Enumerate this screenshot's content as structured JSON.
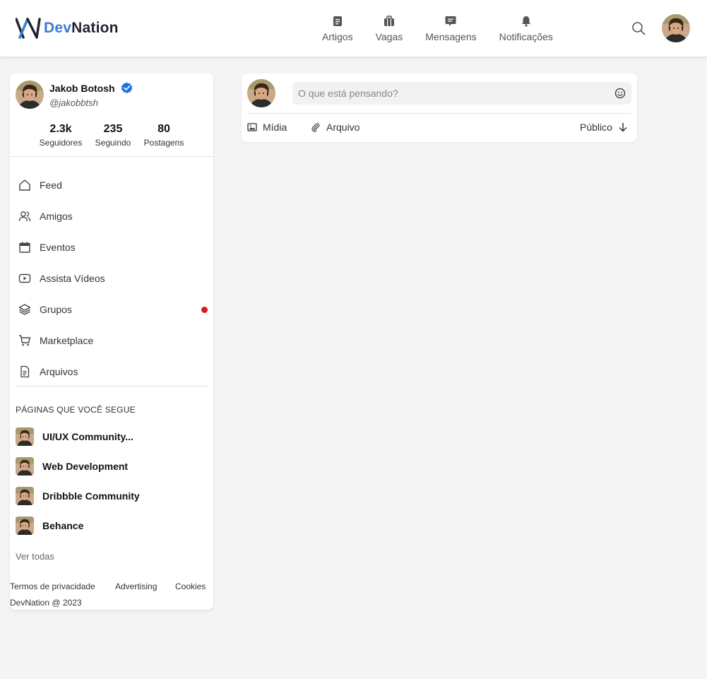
{
  "brand": {
    "prefix": "Dev",
    "suffix": "Nation",
    "accent": "#3a7bd5"
  },
  "nav": {
    "items": [
      {
        "label": "Artigos",
        "icon": "article-icon"
      },
      {
        "label": "Vagas",
        "icon": "briefcase-icon"
      },
      {
        "label": "Mensagens",
        "icon": "message-icon"
      },
      {
        "label": "Notificações",
        "icon": "bell-icon"
      }
    ]
  },
  "profile": {
    "name": "Jakob Botosh",
    "handle": "@jakobbtsh",
    "stats": [
      {
        "value": "2.3k",
        "label": "Seguidores"
      },
      {
        "value": "235",
        "label": "Seguindo"
      },
      {
        "value": "80",
        "label": "Postagens"
      }
    ]
  },
  "menu": {
    "items": [
      {
        "label": "Feed",
        "icon": "home-icon"
      },
      {
        "label": "Amigos",
        "icon": "users-icon"
      },
      {
        "label": "Eventos",
        "icon": "calendar-icon"
      },
      {
        "label": "Assista Vídeos",
        "icon": "video-icon"
      },
      {
        "label": "Grupos",
        "icon": "layers-icon",
        "notification_color": "#e01818"
      },
      {
        "label": "Marketplace",
        "icon": "cart-icon"
      },
      {
        "label": "Arquivos",
        "icon": "file-icon"
      }
    ]
  },
  "pages": {
    "title": "PÁGINAS QUE VOCÊ SEGUE",
    "items": [
      {
        "label": "UI/UX Community..."
      },
      {
        "label": "Web Development"
      },
      {
        "label": "Dribbble Community"
      },
      {
        "label": "Behance"
      }
    ],
    "see_all": "Ver todas"
  },
  "footer": {
    "links": [
      "Termos de privacidade",
      "Advertising",
      "Cookies"
    ],
    "copyright": "DevNation @ 2023"
  },
  "composer": {
    "placeholder": "O que está pensando?",
    "actions": [
      {
        "label": "Mídia",
        "icon": "image-icon"
      },
      {
        "label": "Arquivo",
        "icon": "paperclip-icon"
      }
    ],
    "visibility": "Público"
  }
}
